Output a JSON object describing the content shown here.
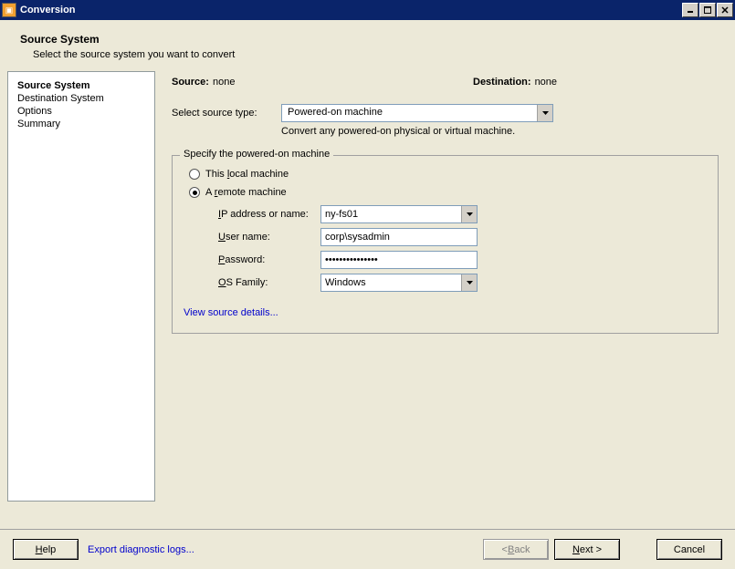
{
  "titlebar": {
    "title": "Conversion"
  },
  "header": {
    "title": "Source System",
    "subtitle": "Select the source system you want to convert"
  },
  "sidebar": {
    "items": [
      {
        "label": "Source System",
        "active": true
      },
      {
        "label": "Destination System",
        "active": false
      },
      {
        "label": "Options",
        "active": false
      },
      {
        "label": "Summary",
        "active": false
      }
    ]
  },
  "main": {
    "source_label": "Source:",
    "source_value": "none",
    "destination_label": "Destination:",
    "destination_value": "none",
    "select_source_type_label": "Select source type:",
    "source_type_value": "Powered-on machine",
    "source_type_help": "Convert any powered-on physical or virtual machine.",
    "fieldset_legend": "Specify the powered-on machine",
    "radio_local_prefix": "This ",
    "radio_local_underline": "l",
    "radio_local_suffix": "ocal machine",
    "radio_remote_prefix": "A ",
    "radio_remote_underline": "r",
    "radio_remote_suffix": "emote machine",
    "ip_label_prefix": "",
    "ip_label_underline": "I",
    "ip_label_suffix": "P address or name:",
    "ip_value": "ny-fs01",
    "user_label_underline": "U",
    "user_label_suffix": "ser name:",
    "user_value": "corp\\sysadmin",
    "password_label_underline": "P",
    "password_label_suffix": "assword:",
    "password_value": "•••••••••••••••",
    "os_label_underline": "O",
    "os_label_suffix": "S Family:",
    "os_value": "Windows",
    "view_details_link": "View source details..."
  },
  "footer": {
    "help_underline": "H",
    "help_suffix": "elp",
    "export_logs": "Export diagnostic logs...",
    "back_prefix": "< ",
    "back_underline": "B",
    "back_suffix": "ack",
    "next_underline": "N",
    "next_suffix": "ext >",
    "cancel": "Cancel"
  }
}
